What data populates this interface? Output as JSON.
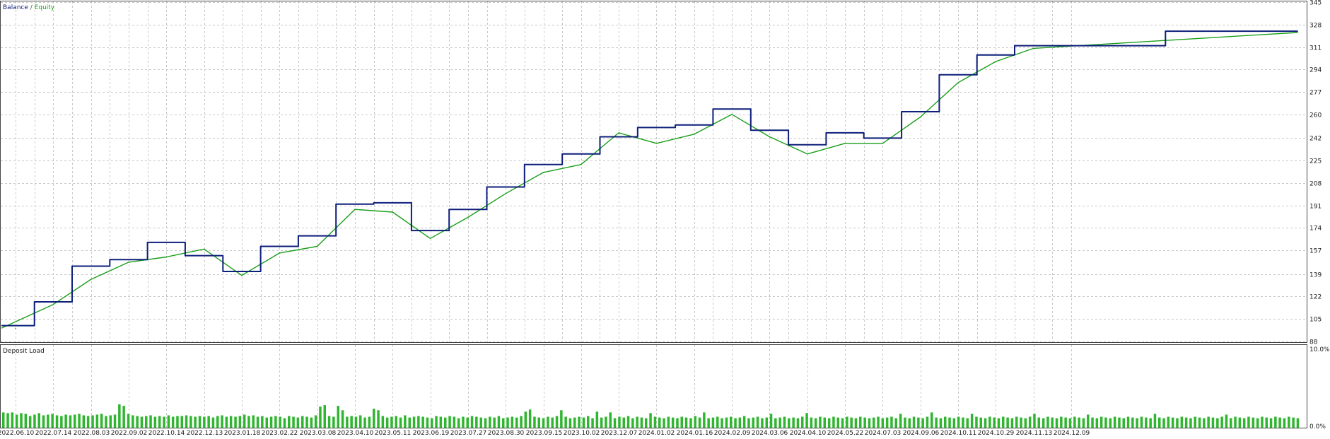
{
  "legend": {
    "balance_label": "Balance",
    "separator": " / ",
    "equity_label": "Equity"
  },
  "colors": {
    "balance": "#0c1f7a",
    "equity": "#1a9e1a",
    "deposit_bar": "#2fb52f",
    "grid": "#c8c8c8",
    "axis_text": "#1a1a1a"
  },
  "chart_data": [
    {
      "type": "line",
      "title": "",
      "y_ticks": [
        88,
        105,
        122,
        139,
        157,
        174,
        191,
        208,
        225,
        242,
        260,
        277,
        294,
        311,
        328,
        345
      ],
      "ylim": [
        88,
        345
      ],
      "x": [
        "2022.06.10",
        "2022.07.14",
        "2022.08.03",
        "2022.09.02",
        "2022.10.14",
        "2022.12.13",
        "2023.01.18",
        "2023.02.22",
        "2023.03.08",
        "2023.04.10",
        "2023.05.11",
        "2023.06.19",
        "2023.07.27",
        "2023.08.30",
        "2023.09.15",
        "2023.10.02",
        "2023.12.07",
        "2024.01.02",
        "2024.01.16",
        "2024.02.09",
        "2024.03.06",
        "2024.04.10",
        "2024.05.22",
        "2024.07.03",
        "2024.09.06",
        "2024.10.11",
        "2024.10.29",
        "2024.11.13",
        "2024.12.09"
      ],
      "series": [
        {
          "name": "Balance",
          "values": [
            100,
            118,
            145,
            150,
            163,
            153,
            141,
            160,
            168,
            192,
            193,
            172,
            188,
            205,
            222,
            230,
            243,
            250,
            252,
            264,
            248,
            237,
            246,
            242,
            262,
            290,
            305,
            312,
            323
          ]
        },
        {
          "name": "Equity",
          "values": [
            98,
            116,
            135,
            148,
            152,
            158,
            138,
            155,
            160,
            188,
            186,
            166,
            182,
            200,
            216,
            222,
            246,
            238,
            245,
            260,
            243,
            230,
            238,
            238,
            258,
            284,
            300,
            310,
            322
          ]
        }
      ]
    },
    {
      "type": "bar",
      "title": "Deposit Load",
      "y_ticks": [
        "10.0%",
        "0.0%"
      ],
      "ylim": [
        0,
        10
      ],
      "values": [
        2.1,
        2.0,
        2.1,
        1.8,
        2.0,
        1.9,
        1.6,
        1.8,
        2.0,
        1.7,
        1.8,
        1.9,
        1.7,
        1.6,
        1.8,
        1.7,
        1.8,
        1.9,
        1.7,
        1.6,
        1.7,
        1.8,
        1.9,
        1.6,
        1.7,
        1.8,
        3.2,
        3.0,
        1.9,
        1.7,
        1.6,
        1.5,
        1.6,
        1.7,
        1.5,
        1.6,
        1.5,
        1.7,
        1.5,
        1.6,
        1.6,
        1.7,
        1.6,
        1.5,
        1.6,
        1.5,
        1.6,
        1.4,
        1.6,
        1.7,
        1.5,
        1.6,
        1.5,
        1.6,
        1.8,
        1.6,
        1.7,
        1.5,
        1.6,
        1.4,
        1.5,
        1.6,
        1.5,
        1.3,
        1.6,
        1.5,
        1.4,
        1.6,
        1.5,
        1.4,
        1.7,
        2.9,
        3.1,
        1.6,
        1.5,
        3.0,
        2.4,
        1.5,
        1.6,
        1.5,
        1.7,
        1.4,
        1.5,
        2.6,
        2.4,
        1.6,
        1.4,
        1.5,
        1.6,
        1.4,
        1.7,
        1.4,
        1.5,
        1.6,
        1.5,
        1.4,
        1.3,
        1.6,
        1.5,
        1.4,
        1.6,
        1.5,
        1.3,
        1.5,
        1.4,
        1.6,
        1.5,
        1.4,
        1.3,
        1.5,
        1.4,
        1.6,
        1.3,
        1.4,
        1.5,
        1.4,
        1.6,
        2.2,
        2.5,
        1.5,
        1.4,
        1.3,
        1.5,
        1.4,
        1.6,
        2.4,
        1.5,
        1.3,
        1.4,
        1.5,
        1.4,
        1.6,
        1.3,
        2.2,
        1.4,
        1.5,
        2.1,
        1.3,
        1.5,
        1.4,
        1.6,
        1.3,
        1.5,
        1.4,
        1.3,
        2.0,
        1.5,
        1.4,
        1.3,
        1.5,
        1.4,
        1.3,
        1.5,
        1.4,
        1.3,
        1.6,
        1.4,
        2.1,
        1.3,
        1.4,
        1.5,
        1.3,
        1.4,
        1.5,
        1.3,
        1.4,
        1.6,
        1.3,
        1.4,
        1.5,
        1.3,
        1.4,
        1.9,
        1.3,
        1.4,
        1.5,
        1.3,
        1.4,
        1.3,
        1.5,
        2.0,
        1.4,
        1.3,
        1.5,
        1.4,
        1.3,
        1.5,
        1.4,
        1.3,
        1.5,
        1.4,
        1.3,
        1.5,
        1.4,
        1.3,
        1.4,
        1.5,
        1.3,
        1.4,
        1.5,
        1.3,
        1.9,
        1.4,
        1.3,
        1.5,
        1.4,
        1.3,
        1.5,
        2.1,
        1.4,
        1.3,
        1.5,
        1.4,
        1.3,
        1.5,
        1.4,
        1.3,
        1.9,
        1.5,
        1.4,
        1.3,
        1.5,
        1.4,
        1.3,
        1.5,
        1.4,
        1.3,
        1.5,
        1.4,
        1.3,
        1.5,
        1.9,
        1.4,
        1.3,
        1.5,
        1.4,
        1.3,
        1.5,
        1.4,
        1.3,
        1.5,
        1.4,
        1.3,
        1.8,
        1.4,
        1.3,
        1.5,
        1.4,
        1.3,
        1.5,
        1.4,
        1.3,
        1.5,
        1.4,
        1.3,
        1.5,
        1.4,
        1.3,
        1.9,
        1.4,
        1.3,
        1.5,
        1.4,
        1.3,
        1.5,
        1.4,
        1.3,
        1.5,
        1.4,
        1.3,
        1.5,
        1.4,
        1.3,
        1.5,
        1.8,
        1.3,
        1.5,
        1.4,
        1.3,
        1.5,
        1.4,
        1.3,
        1.5,
        1.4,
        1.3,
        1.5,
        1.4,
        1.3,
        1.5,
        1.4,
        1.3
      ]
    }
  ]
}
